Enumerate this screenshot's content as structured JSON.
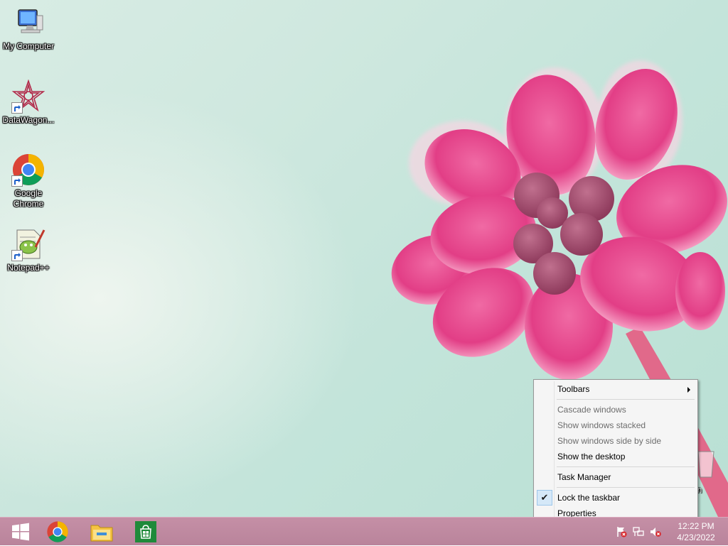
{
  "desktop": {
    "icons": [
      {
        "label": "My Computer",
        "icon": "computer-icon"
      },
      {
        "label": "DataWagon...",
        "icon": "datawagon-icon"
      },
      {
        "label": "Google Chrome",
        "icon": "chrome-icon"
      },
      {
        "label": "Notepad++",
        "icon": "notepadpp-icon"
      }
    ],
    "recycle_bin_label": "e Bin"
  },
  "context_menu": {
    "toolbars": "Toolbars",
    "cascade": "Cascade windows",
    "stacked": "Show windows stacked",
    "side_by_side": "Show windows side by side",
    "show_desktop": "Show the desktop",
    "task_manager": "Task Manager",
    "lock_taskbar": "Lock the taskbar",
    "lock_checked": true,
    "properties": "Properties",
    "check_mark": "✔"
  },
  "taskbar": {
    "pinned": [
      "start-button",
      "chrome",
      "file-explorer",
      "store"
    ],
    "time": "12:22 PM",
    "date": "4/23/2022"
  },
  "colors": {
    "taskbar": "#c58fa6",
    "flower": "#e8488a",
    "menu_bg": "#f5f5f5",
    "start_green": "#1f8a3a"
  }
}
